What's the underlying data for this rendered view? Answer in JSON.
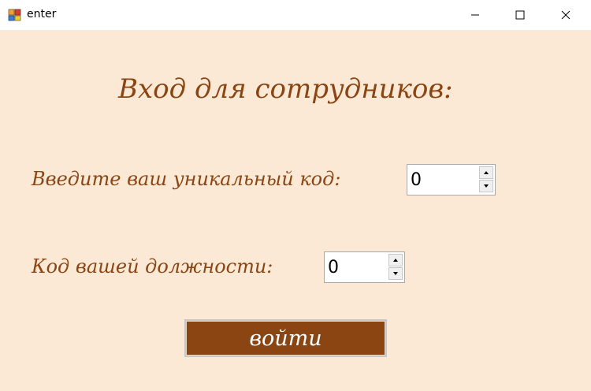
{
  "window": {
    "title": "enter",
    "icon": "winforms-app-icon",
    "controls": [
      "minimize-icon",
      "maximize-icon",
      "close-icon"
    ]
  },
  "colors": {
    "background": "#fbe9d6",
    "accent": "#8b4513",
    "button_text": "#ffffff"
  },
  "form": {
    "heading": "Вход для сотрудников:",
    "unique_code": {
      "label": "Введите ваш уникальный код:",
      "value": "0"
    },
    "position_code": {
      "label": "Код вашей должности:",
      "value": "0"
    },
    "submit_label": "войти"
  }
}
